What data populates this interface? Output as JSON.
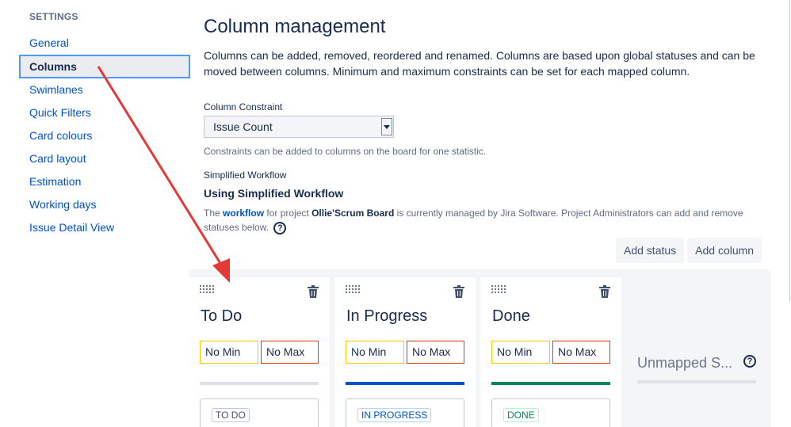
{
  "sidebar": {
    "heading": "SETTINGS",
    "items": [
      {
        "label": "General",
        "active": false
      },
      {
        "label": "Columns",
        "active": true
      },
      {
        "label": "Swimlanes",
        "active": false
      },
      {
        "label": "Quick Filters",
        "active": false
      },
      {
        "label": "Card colours",
        "active": false
      },
      {
        "label": "Card layout",
        "active": false
      },
      {
        "label": "Estimation",
        "active": false
      },
      {
        "label": "Working days",
        "active": false
      },
      {
        "label": "Issue Detail View",
        "active": false
      }
    ]
  },
  "main": {
    "title": "Column management",
    "description": "Columns can be added, removed, reordered and renamed. Columns are based upon global statuses and can be moved between columns. Minimum and maximum constraints can be set for each mapped column.",
    "constraint": {
      "label": "Column Constraint",
      "value": "Issue Count",
      "help": "Constraints can be added to columns on the board for one statistic."
    },
    "workflow": {
      "label": "Simplified Workflow",
      "title": "Using Simplified Workflow",
      "desc_prefix": "The",
      "desc_link": "workflow",
      "desc_mid": "for project",
      "desc_project": "Ollie'Scrum Board",
      "desc_suffix": "is currently managed by Jira Software. Project Administrators can add and remove statuses below.",
      "help_glyph": "?"
    },
    "buttons": {
      "add_status": "Add status",
      "add_column": "Add column"
    }
  },
  "board": {
    "columns": [
      {
        "name": "To Do",
        "min": "No Min",
        "max": "No Max",
        "bar_color": "#dfe1e6",
        "status": "TO DO",
        "status_color": "#42526e",
        "status_border": "#c1c7d0"
      },
      {
        "name": "In Progress",
        "min": "No Min",
        "max": "No Max",
        "bar_color": "#0052cc",
        "status": "IN PROGRESS",
        "status_color": "#0052cc",
        "status_border": "#b3d4ff"
      },
      {
        "name": "Done",
        "min": "No Min",
        "max": "No Max",
        "bar_color": "#00875a",
        "status": "DONE",
        "status_color": "#00875a",
        "status_border": "#abf5d1"
      }
    ],
    "unmapped": {
      "title": "Unmapped S...",
      "help_glyph": "?"
    }
  },
  "colors": {
    "accent": "#0052cc",
    "annotation_arrow": "#e53935"
  }
}
